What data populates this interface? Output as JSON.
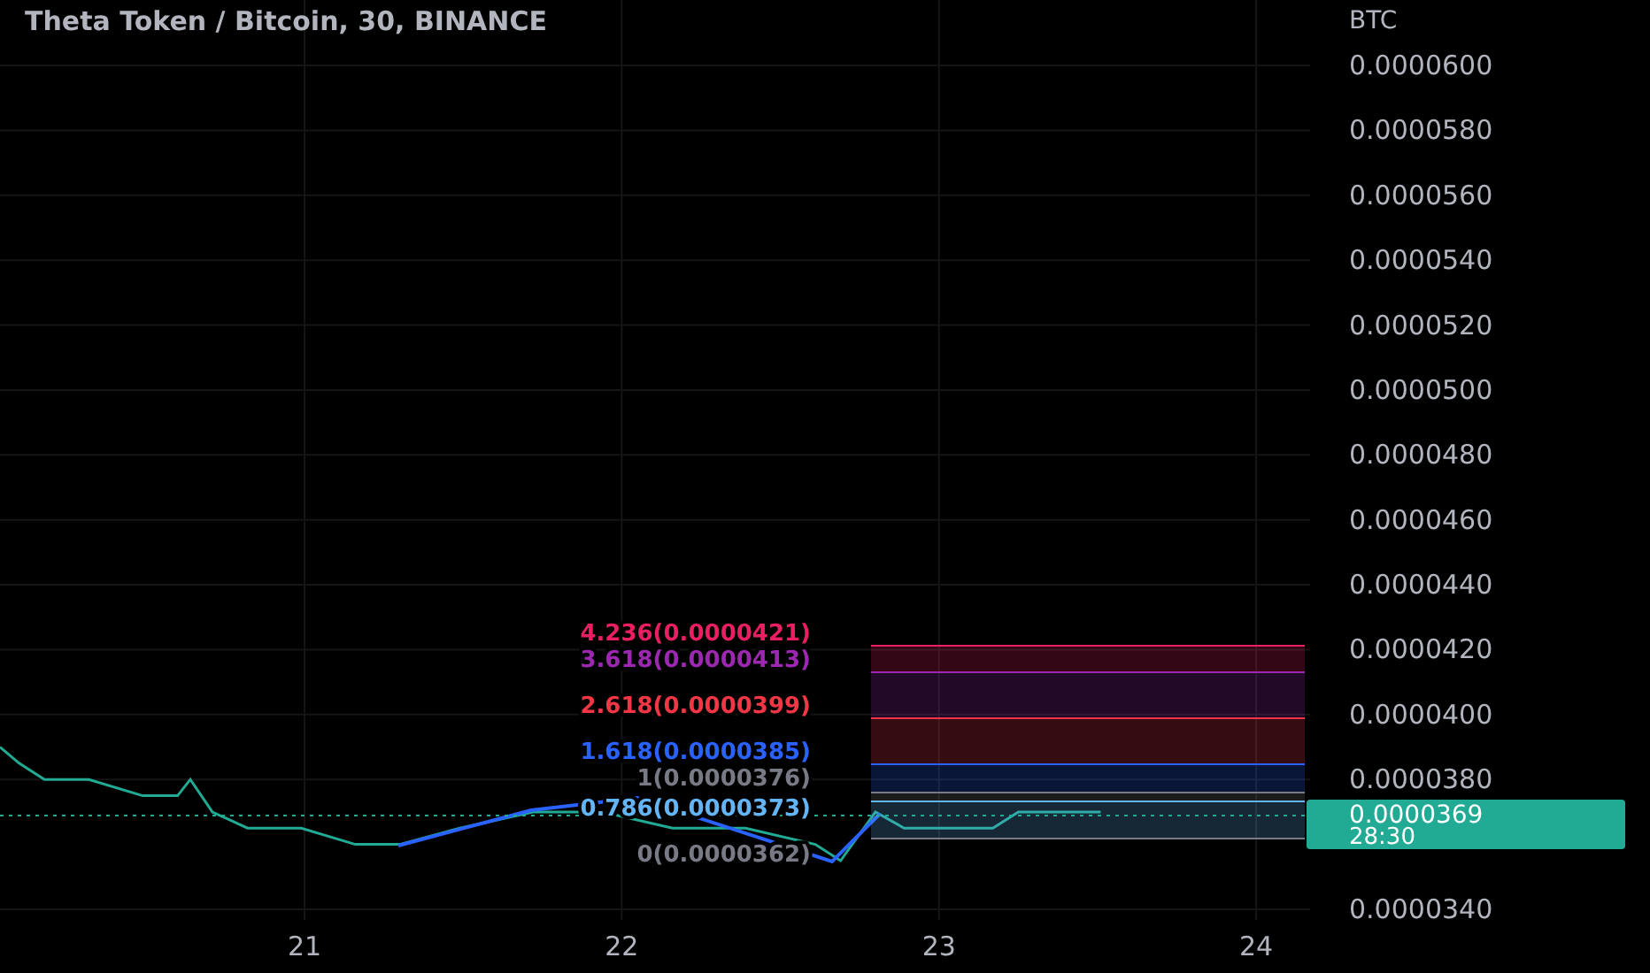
{
  "chart_data": {
    "type": "line",
    "title": "Theta Token / Bitcoin, 30, BINANCE",
    "ylabel": "BTC",
    "grid": true,
    "x": [
      20.04,
      20.1,
      20.18,
      20.32,
      20.49,
      20.6,
      20.64,
      20.71,
      20.82,
      20.99,
      21.16,
      21.3,
      21.49,
      21.72,
      21.94,
      22.16,
      22.39,
      22.61,
      22.69,
      22.8,
      22.89,
      23.06,
      23.17,
      23.25,
      23.39,
      23.51
    ],
    "series": [
      {
        "color": "#22ab94",
        "values": [
          3.9e-05,
          3.85e-05,
          3.8e-05,
          3.8e-05,
          3.75e-05,
          3.75e-05,
          3.8e-05,
          3.7e-05,
          3.65e-05,
          3.65e-05,
          3.6e-05,
          3.6e-05,
          3.65e-05,
          3.7e-05,
          3.7e-05,
          3.65e-05,
          3.65e-05,
          3.6e-05,
          3.55e-05,
          3.7e-05,
          3.65e-05,
          3.65e-05,
          3.65e-05,
          3.7e-05,
          3.7e-05,
          3.7e-05
        ]
      }
    ],
    "xlim": [
      20.04,
      24.17
    ],
    "ylim": [
      3.4e-05,
      6e-05
    ],
    "xticks": [
      21,
      22,
      23,
      24
    ],
    "yticks": [
      {
        "value": 6e-05,
        "label": "0.0000600"
      },
      {
        "value": 5.8e-05,
        "label": "0.0000580"
      },
      {
        "value": 5.6e-05,
        "label": "0.0000560"
      },
      {
        "value": 5.4e-05,
        "label": "0.0000540"
      },
      {
        "value": 5.2e-05,
        "label": "0.0000520"
      },
      {
        "value": 5e-05,
        "label": "0.0000500"
      },
      {
        "value": 4.8e-05,
        "label": "0.0000480"
      },
      {
        "value": 4.6e-05,
        "label": "0.0000460"
      },
      {
        "value": 4.4e-05,
        "label": "0.0000440"
      },
      {
        "value": 4.2e-05,
        "label": "0.0000420"
      },
      {
        "value": 4e-05,
        "label": "0.0000400"
      },
      {
        "value": 3.8e-05,
        "label": "0.0000380"
      },
      {
        "value": 3.4e-05,
        "label": "0.0000340"
      }
    ]
  },
  "fib_levels": [
    {
      "label": "4.236(0.0000421)",
      "color": "#e91e63"
    },
    {
      "label": "3.618(0.0000413)",
      "color": "#9c27b0"
    },
    {
      "label": "2.618(0.0000399)",
      "color": "#f23645"
    },
    {
      "label": "1.618(0.0000385)",
      "color": "#2962ff"
    },
    {
      "label": "1(0.0000376)",
      "color": "#787b86"
    },
    {
      "label": "0.786(0.0000373)",
      "color": "#64b5f6"
    },
    {
      "label": "0(0.0000362)",
      "color": "#787b86"
    }
  ],
  "current_price": {
    "price": "0.0000369",
    "countdown": "28:30"
  }
}
